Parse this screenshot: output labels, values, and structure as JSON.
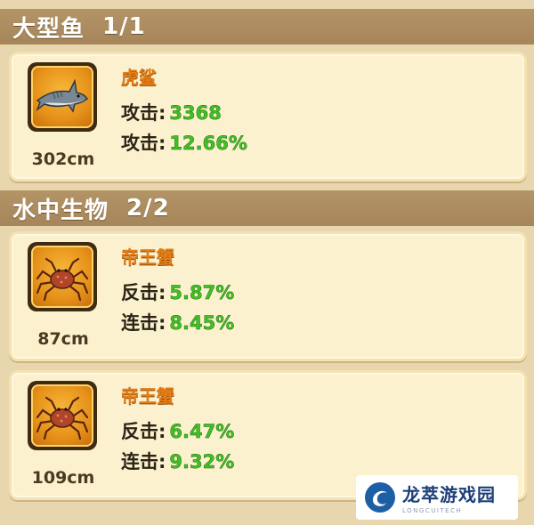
{
  "sections": [
    {
      "title": "大型鱼",
      "count": "1/1",
      "items": [
        {
          "icon": "shark-icon",
          "name": "虎鲨",
          "size": "302cm",
          "stats": [
            {
              "label": "攻击",
              "value": "3368"
            },
            {
              "label": "攻击",
              "value": "12.66%"
            }
          ]
        }
      ]
    },
    {
      "title": "水中生物",
      "count": "2/2",
      "items": [
        {
          "icon": "crab-icon",
          "name": "帝王蟹",
          "size": "87cm",
          "stats": [
            {
              "label": "反击",
              "value": "5.87%"
            },
            {
              "label": "连击",
              "value": "8.45%"
            }
          ]
        },
        {
          "icon": "crab-icon",
          "name": "帝王蟹",
          "size": "109cm",
          "stats": [
            {
              "label": "反击",
              "value": "6.47%"
            },
            {
              "label": "连击",
              "value": "9.32%"
            }
          ]
        }
      ]
    }
  ],
  "colors": {
    "header_bg": "#a58559",
    "card_bg": "#fbf1ce",
    "name_color": "#e57d16",
    "value_color": "#43c024"
  },
  "watermark": {
    "title": "龙萃游戏园",
    "subtitle": "LONGCUITECH"
  }
}
